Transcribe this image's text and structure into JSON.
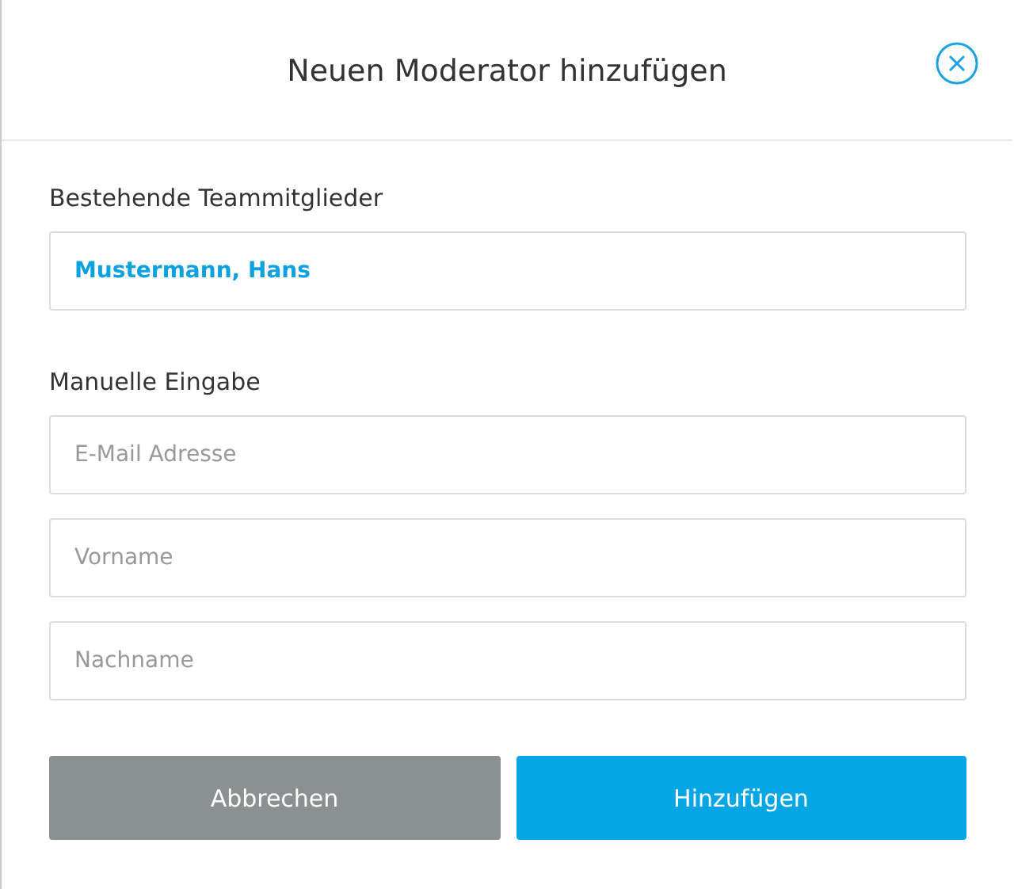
{
  "dialog": {
    "title": "Neuen Moderator hinzufügen"
  },
  "team_members": {
    "label": "Bestehende Teammitglieder",
    "value": "Mustermann, Hans"
  },
  "manual_entry": {
    "label": "Manuelle Eingabe",
    "fields": [
      {
        "placeholder": "E-Mail Adresse"
      },
      {
        "placeholder": "Vorname"
      },
      {
        "placeholder": "Nachname"
      }
    ]
  },
  "buttons": [
    {
      "label": "Abbrechen",
      "kind": "secondary"
    },
    {
      "label": "Hinzufügen",
      "kind": "primary"
    }
  ]
}
